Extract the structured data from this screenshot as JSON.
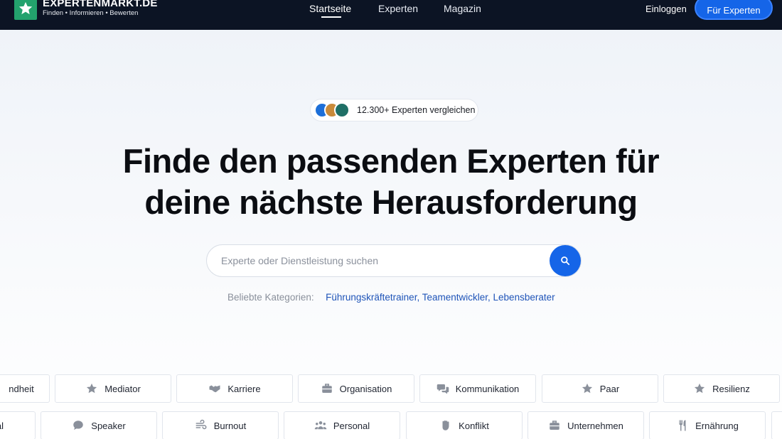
{
  "nav": {
    "brand_title": "EXPERTENMARKT.DE",
    "brand_tagline": "Finden • Informieren • Bewerten",
    "links": [
      {
        "label": "Startseite",
        "active": true
      },
      {
        "label": "Experten",
        "active": false
      },
      {
        "label": "Magazin",
        "active": false
      }
    ],
    "login_label": "Einloggen",
    "cta_label": "Für Experten"
  },
  "hero": {
    "badge_text": "12.300+ Experten vergleichen",
    "headline_line1": "Finde den passenden Experten für",
    "headline_line2": "deine nächste Herausforderung",
    "search_placeholder": "Experte oder Dienstleistung suchen",
    "popular_label": "Beliebte Kategorien:",
    "popular_links": [
      "Führungskräftetrainer",
      "Teamentwickler",
      "Lebensberater"
    ]
  },
  "categories_row1": [
    {
      "label": "ndheit",
      "icon": "heart-icon"
    },
    {
      "label": "Mediator",
      "icon": "star-icon"
    },
    {
      "label": "Karriere",
      "icon": "handshake-icon"
    },
    {
      "label": "Organisation",
      "icon": "briefcase-icon"
    },
    {
      "label": "Kommunikation",
      "icon": "chat-bubbles-icon"
    },
    {
      "label": "Paar",
      "icon": "star-icon"
    },
    {
      "label": "Resilienz",
      "icon": "star-icon"
    }
  ],
  "categories_row2": [
    {
      "label": "al",
      "icon": "star-icon"
    },
    {
      "label": "Speaker",
      "icon": "speech-bubble-icon"
    },
    {
      "label": "Burnout",
      "icon": "wind-icon"
    },
    {
      "label": "Personal",
      "icon": "people-icon"
    },
    {
      "label": "Konflikt",
      "icon": "fist-icon"
    },
    {
      "label": "Unternehmen",
      "icon": "briefcase-icon"
    },
    {
      "label": "Ernährung",
      "icon": "fork-knife-icon"
    }
  ],
  "colors": {
    "nav_bg": "#0c1424",
    "accent_blue": "#1565e8",
    "brand_green": "#23a26d",
    "link_blue": "#1f54b8"
  }
}
